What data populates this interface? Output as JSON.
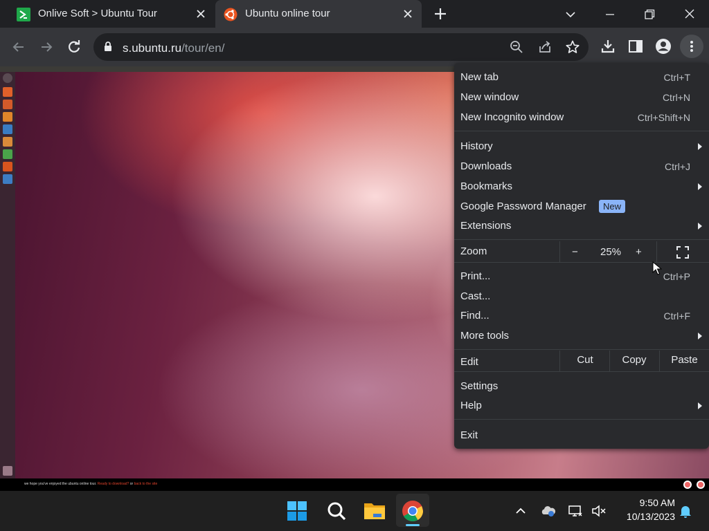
{
  "browser": {
    "tabs": [
      {
        "title": "Onlive Soft > Ubuntu Tour",
        "active": false
      },
      {
        "title": "Ubuntu online tour",
        "active": true
      }
    ],
    "url": {
      "host": "s.ubuntu.ru",
      "path": "/tour/en/"
    }
  },
  "menu": {
    "items": {
      "new_tab": {
        "label": "New tab",
        "shortcut": "Ctrl+T"
      },
      "new_window": {
        "label": "New window",
        "shortcut": "Ctrl+N"
      },
      "new_incognito": {
        "label": "New Incognito window",
        "shortcut": "Ctrl+Shift+N"
      },
      "history": {
        "label": "History"
      },
      "downloads": {
        "label": "Downloads",
        "shortcut": "Ctrl+J"
      },
      "bookmarks": {
        "label": "Bookmarks"
      },
      "password_manager": {
        "label": "Google Password Manager",
        "badge": "New"
      },
      "extensions": {
        "label": "Extensions"
      },
      "print": {
        "label": "Print...",
        "shortcut": "Ctrl+P"
      },
      "cast": {
        "label": "Cast..."
      },
      "find": {
        "label": "Find...",
        "shortcut": "Ctrl+F"
      },
      "more_tools": {
        "label": "More tools"
      },
      "settings": {
        "label": "Settings"
      },
      "help": {
        "label": "Help"
      },
      "exit": {
        "label": "Exit"
      }
    },
    "zoom": {
      "label": "Zoom",
      "minus": "−",
      "value": "25%",
      "plus": "+"
    },
    "edit": {
      "label": "Edit",
      "cut": "Cut",
      "copy": "Copy",
      "paste": "Paste"
    }
  },
  "page": {
    "bottom_text": {
      "prefix": "we hope you've enjoyed the ubuntu online tour.",
      "download_link": "Ready to download?",
      "or": "or",
      "back_link": "back to the site"
    }
  },
  "taskbar": {
    "time": "9:50 AM",
    "date": "10/13/2023"
  },
  "colors": {
    "chrome_dark": "#202124",
    "menu_bg": "#292a2d",
    "badge_blue": "#8ab4f8",
    "ubuntu_orange": "#e95420",
    "accent": "#60cdff"
  }
}
